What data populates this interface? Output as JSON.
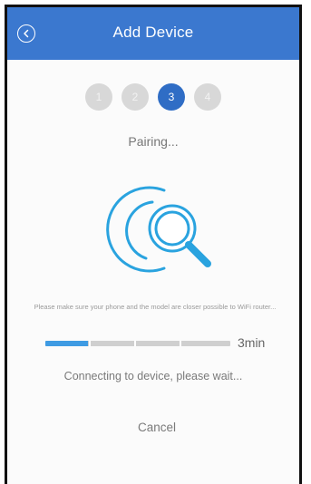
{
  "header": {
    "title": "Add Device",
    "back_icon": "chevron-left-circle-icon"
  },
  "steps": {
    "labels": [
      "1",
      "2",
      "3",
      "4"
    ],
    "active_step": 3,
    "active_color": "#2f6dc5",
    "inactive_color": "#d8d8d8"
  },
  "status": {
    "title": "Pairing...",
    "hint": "Please make sure your phone and the model are closer possible to WiFi router...",
    "connecting": "Connecting to device, please wait..."
  },
  "progress": {
    "fraction": 0.23,
    "time_label": "3min",
    "fill_color": "#3f9be3"
  },
  "actions": {
    "cancel_label": "Cancel"
  },
  "illustration": {
    "icon": "search-device-icon",
    "color": "#2aa3df"
  },
  "colors": {
    "header_bg": "#3b78cf"
  }
}
